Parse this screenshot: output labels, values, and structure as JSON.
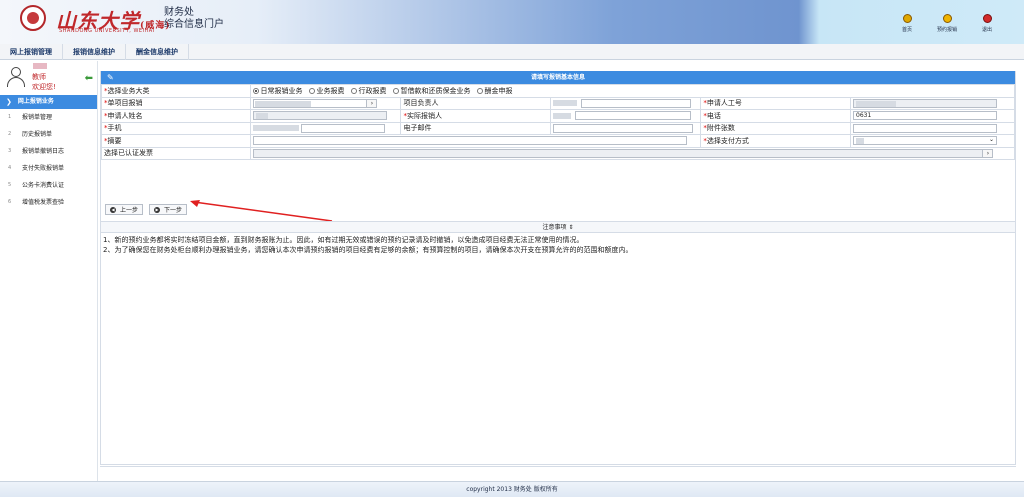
{
  "header": {
    "logo_cn": "山东大学",
    "logo_campus": "(威海)",
    "logo_en": "SHANDONG UNIVERSITY, WEIHAI",
    "title_line1": "财务处",
    "title_line2": "综合信息门户",
    "nav": [
      {
        "label": "首页",
        "icon": "home-icon",
        "color": "#e0a800"
      },
      {
        "label": "预约报销",
        "icon": "reserve-icon",
        "color": "#f0b400"
      },
      {
        "label": "退出",
        "icon": "exit-icon",
        "color": "#d22a2a"
      }
    ]
  },
  "menubar": [
    "网上报销管理",
    "报销信息维护",
    "酬金信息维护"
  ],
  "sidebar": {
    "role": "教师",
    "welcome": "欢迎您!",
    "section": "网上报销业务",
    "items": [
      {
        "num": "1",
        "label": "报销单管理"
      },
      {
        "num": "2",
        "label": "历史报销单"
      },
      {
        "num": "3",
        "label": "报销单撤销日志"
      },
      {
        "num": "4",
        "label": "支付失败报销单"
      },
      {
        "num": "5",
        "label": "公务卡消费认证"
      },
      {
        "num": "6",
        "label": "增值税发票查验"
      }
    ]
  },
  "form": {
    "title": "请填写报销基本信息",
    "business_type_label": "选择业务大类",
    "business_types": [
      {
        "label": "日常报销业务",
        "selected": true
      },
      {
        "label": "业务报费",
        "selected": false
      },
      {
        "label": "行政报费",
        "selected": false
      },
      {
        "label": "暂借款和还质保金业务",
        "selected": false
      },
      {
        "label": "酬金申报",
        "selected": false
      }
    ],
    "single_project_label": "单项目报销",
    "project_leader_label": "项目负责人",
    "applicant_id_label": "申请人工号",
    "applicant_name_label": "申请人姓名",
    "actual_reimburser_label": "实际报销人",
    "phone_label": "电话",
    "mobile_label": "手机",
    "email_label": "电子邮件",
    "attachments_label": "附件张数",
    "summary_label": "摘要",
    "payment_method_label": "选择支付方式",
    "certified_invoice_label": "选择已认证发票",
    "phone_value_partial": "0631"
  },
  "buttons": {
    "prev": "上一步",
    "next": "下一步"
  },
  "notes": {
    "header": "注意事项 ⇕",
    "lines": [
      "1、新的预约业务都将实时冻结项目金额，直到财务报账为止。因此，如有过期无效或错误的预约记录请及时撤销，以免造成项目经费无法正常使用的情况。",
      "2、为了确保您在财务处柜台顺利办理报销业务，请您确认本次申请预约报销的项目经费有足够的余额；有预算控制的项目，请确保本次开支在预算允许的的范围和额度内。"
    ]
  },
  "footer": "copyright 2013 财务处 版权所有",
  "colors": {
    "accent": "#3c8be0",
    "required": "#dd0000",
    "brand_red": "#c0282b"
  }
}
